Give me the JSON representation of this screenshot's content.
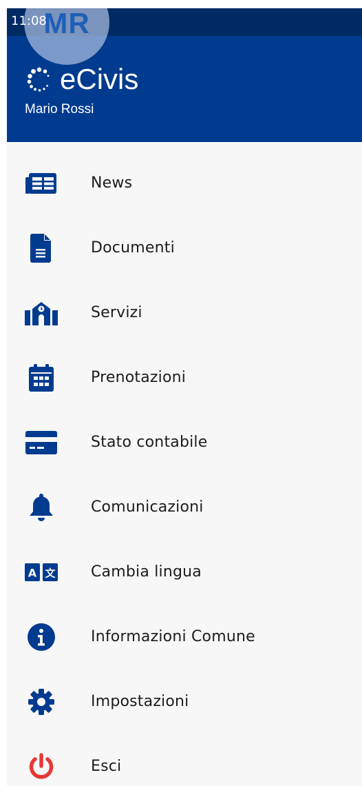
{
  "status_bar": {
    "time": "11:08"
  },
  "header": {
    "avatar_initials": "MR",
    "brand_name": "eCivis",
    "user_name": "Mario Rossi"
  },
  "colors": {
    "header_bg": "#003b8f",
    "icon": "#003b8f",
    "logout_icon": "#e53935"
  },
  "menu": {
    "items": [
      {
        "label": "News",
        "icon": "newspaper-icon"
      },
      {
        "label": "Documenti",
        "icon": "document-icon"
      },
      {
        "label": "Servizi",
        "icon": "school-building-icon"
      },
      {
        "label": "Prenotazioni",
        "icon": "calendar-icon"
      },
      {
        "label": "Stato contabile",
        "icon": "credit-card-icon"
      },
      {
        "label": "Comunicazioni",
        "icon": "bell-icon"
      },
      {
        "label": "Cambia lingua",
        "icon": "translate-icon"
      },
      {
        "label": "Informazioni Comune",
        "icon": "info-icon"
      },
      {
        "label": "Impostazioni",
        "icon": "gear-icon"
      },
      {
        "label": "Esci",
        "icon": "power-icon"
      }
    ]
  }
}
